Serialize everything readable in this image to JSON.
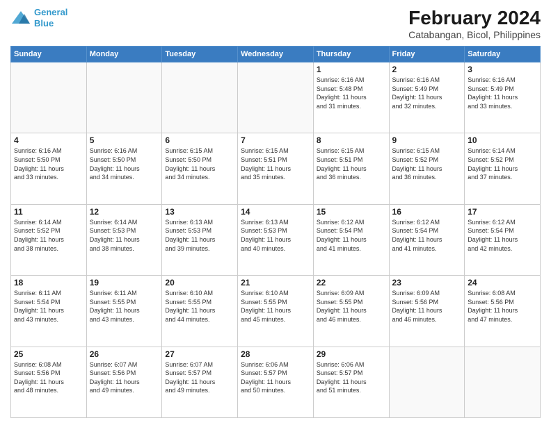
{
  "logo": {
    "line1": "General",
    "line2": "Blue"
  },
  "title": "February 2024",
  "subtitle": "Catabangan, Bicol, Philippines",
  "weekdays": [
    "Sunday",
    "Monday",
    "Tuesday",
    "Wednesday",
    "Thursday",
    "Friday",
    "Saturday"
  ],
  "weeks": [
    [
      {
        "day": "",
        "content": ""
      },
      {
        "day": "",
        "content": ""
      },
      {
        "day": "",
        "content": ""
      },
      {
        "day": "",
        "content": ""
      },
      {
        "day": "1",
        "content": "Sunrise: 6:16 AM\nSunset: 5:48 PM\nDaylight: 11 hours\nand 31 minutes."
      },
      {
        "day": "2",
        "content": "Sunrise: 6:16 AM\nSunset: 5:49 PM\nDaylight: 11 hours\nand 32 minutes."
      },
      {
        "day": "3",
        "content": "Sunrise: 6:16 AM\nSunset: 5:49 PM\nDaylight: 11 hours\nand 33 minutes."
      }
    ],
    [
      {
        "day": "4",
        "content": "Sunrise: 6:16 AM\nSunset: 5:50 PM\nDaylight: 11 hours\nand 33 minutes."
      },
      {
        "day": "5",
        "content": "Sunrise: 6:16 AM\nSunset: 5:50 PM\nDaylight: 11 hours\nand 34 minutes."
      },
      {
        "day": "6",
        "content": "Sunrise: 6:15 AM\nSunset: 5:50 PM\nDaylight: 11 hours\nand 34 minutes."
      },
      {
        "day": "7",
        "content": "Sunrise: 6:15 AM\nSunset: 5:51 PM\nDaylight: 11 hours\nand 35 minutes."
      },
      {
        "day": "8",
        "content": "Sunrise: 6:15 AM\nSunset: 5:51 PM\nDaylight: 11 hours\nand 36 minutes."
      },
      {
        "day": "9",
        "content": "Sunrise: 6:15 AM\nSunset: 5:52 PM\nDaylight: 11 hours\nand 36 minutes."
      },
      {
        "day": "10",
        "content": "Sunrise: 6:14 AM\nSunset: 5:52 PM\nDaylight: 11 hours\nand 37 minutes."
      }
    ],
    [
      {
        "day": "11",
        "content": "Sunrise: 6:14 AM\nSunset: 5:52 PM\nDaylight: 11 hours\nand 38 minutes."
      },
      {
        "day": "12",
        "content": "Sunrise: 6:14 AM\nSunset: 5:53 PM\nDaylight: 11 hours\nand 38 minutes."
      },
      {
        "day": "13",
        "content": "Sunrise: 6:13 AM\nSunset: 5:53 PM\nDaylight: 11 hours\nand 39 minutes."
      },
      {
        "day": "14",
        "content": "Sunrise: 6:13 AM\nSunset: 5:53 PM\nDaylight: 11 hours\nand 40 minutes."
      },
      {
        "day": "15",
        "content": "Sunrise: 6:12 AM\nSunset: 5:54 PM\nDaylight: 11 hours\nand 41 minutes."
      },
      {
        "day": "16",
        "content": "Sunrise: 6:12 AM\nSunset: 5:54 PM\nDaylight: 11 hours\nand 41 minutes."
      },
      {
        "day": "17",
        "content": "Sunrise: 6:12 AM\nSunset: 5:54 PM\nDaylight: 11 hours\nand 42 minutes."
      }
    ],
    [
      {
        "day": "18",
        "content": "Sunrise: 6:11 AM\nSunset: 5:54 PM\nDaylight: 11 hours\nand 43 minutes."
      },
      {
        "day": "19",
        "content": "Sunrise: 6:11 AM\nSunset: 5:55 PM\nDaylight: 11 hours\nand 43 minutes."
      },
      {
        "day": "20",
        "content": "Sunrise: 6:10 AM\nSunset: 5:55 PM\nDaylight: 11 hours\nand 44 minutes."
      },
      {
        "day": "21",
        "content": "Sunrise: 6:10 AM\nSunset: 5:55 PM\nDaylight: 11 hours\nand 45 minutes."
      },
      {
        "day": "22",
        "content": "Sunrise: 6:09 AM\nSunset: 5:55 PM\nDaylight: 11 hours\nand 46 minutes."
      },
      {
        "day": "23",
        "content": "Sunrise: 6:09 AM\nSunset: 5:56 PM\nDaylight: 11 hours\nand 46 minutes."
      },
      {
        "day": "24",
        "content": "Sunrise: 6:08 AM\nSunset: 5:56 PM\nDaylight: 11 hours\nand 47 minutes."
      }
    ],
    [
      {
        "day": "25",
        "content": "Sunrise: 6:08 AM\nSunset: 5:56 PM\nDaylight: 11 hours\nand 48 minutes."
      },
      {
        "day": "26",
        "content": "Sunrise: 6:07 AM\nSunset: 5:56 PM\nDaylight: 11 hours\nand 49 minutes."
      },
      {
        "day": "27",
        "content": "Sunrise: 6:07 AM\nSunset: 5:57 PM\nDaylight: 11 hours\nand 49 minutes."
      },
      {
        "day": "28",
        "content": "Sunrise: 6:06 AM\nSunset: 5:57 PM\nDaylight: 11 hours\nand 50 minutes."
      },
      {
        "day": "29",
        "content": "Sunrise: 6:06 AM\nSunset: 5:57 PM\nDaylight: 11 hours\nand 51 minutes."
      },
      {
        "day": "",
        "content": ""
      },
      {
        "day": "",
        "content": ""
      }
    ]
  ]
}
